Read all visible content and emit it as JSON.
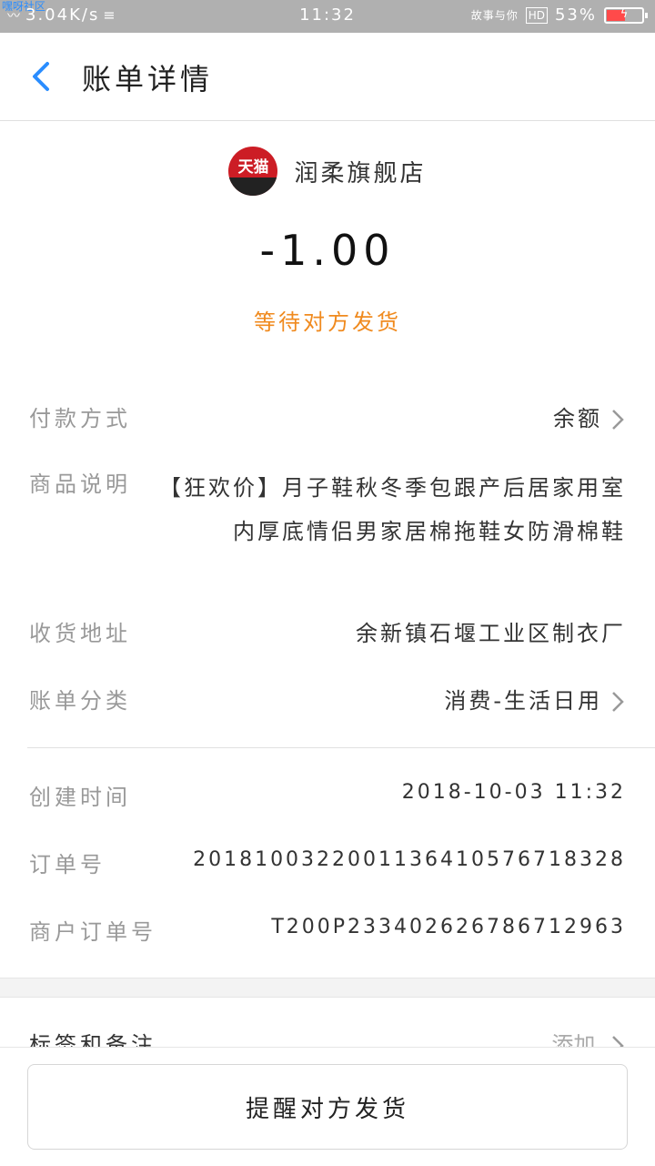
{
  "status_bar": {
    "overlay_text": "嘿呀社区",
    "network_speed": "3.04K/s",
    "time": "11:32",
    "carrier_text": "故事与你",
    "hd_label": "HD",
    "battery_percent": "53%",
    "battery_level": 0.53
  },
  "header": {
    "title": "账单详情"
  },
  "merchant": {
    "logo_text": "天猫",
    "name": "润柔旗舰店"
  },
  "amount": "-1.00",
  "status": "等待对方发货",
  "rows": {
    "payment": {
      "label": "付款方式",
      "value": "余额"
    },
    "product": {
      "label": "商品说明",
      "value": "【狂欢价】月子鞋秋冬季包跟产后居家用室内厚底情侣男家居棉拖鞋女防滑棉鞋"
    },
    "address": {
      "label": "收货地址",
      "value": "余新镇石堰工业区制衣厂"
    },
    "category": {
      "label": "账单分类",
      "value": "消费-生活日用"
    },
    "created": {
      "label": "创建时间",
      "value": "2018-10-03  11:32"
    },
    "order_no": {
      "label": "订单号",
      "value": "2018100322001136410576718328"
    },
    "merchant_order": {
      "label": "商户订单号",
      "value": "T200P2334026267867129​63"
    }
  },
  "tags": {
    "label": "标签和备注",
    "action": "添加"
  },
  "bottom": {
    "button_label": "提醒对方发货"
  },
  "colors": {
    "accent_blue": "#2a8dff",
    "status_orange": "#f08a1e",
    "tmall_red": "#cc1d25"
  }
}
